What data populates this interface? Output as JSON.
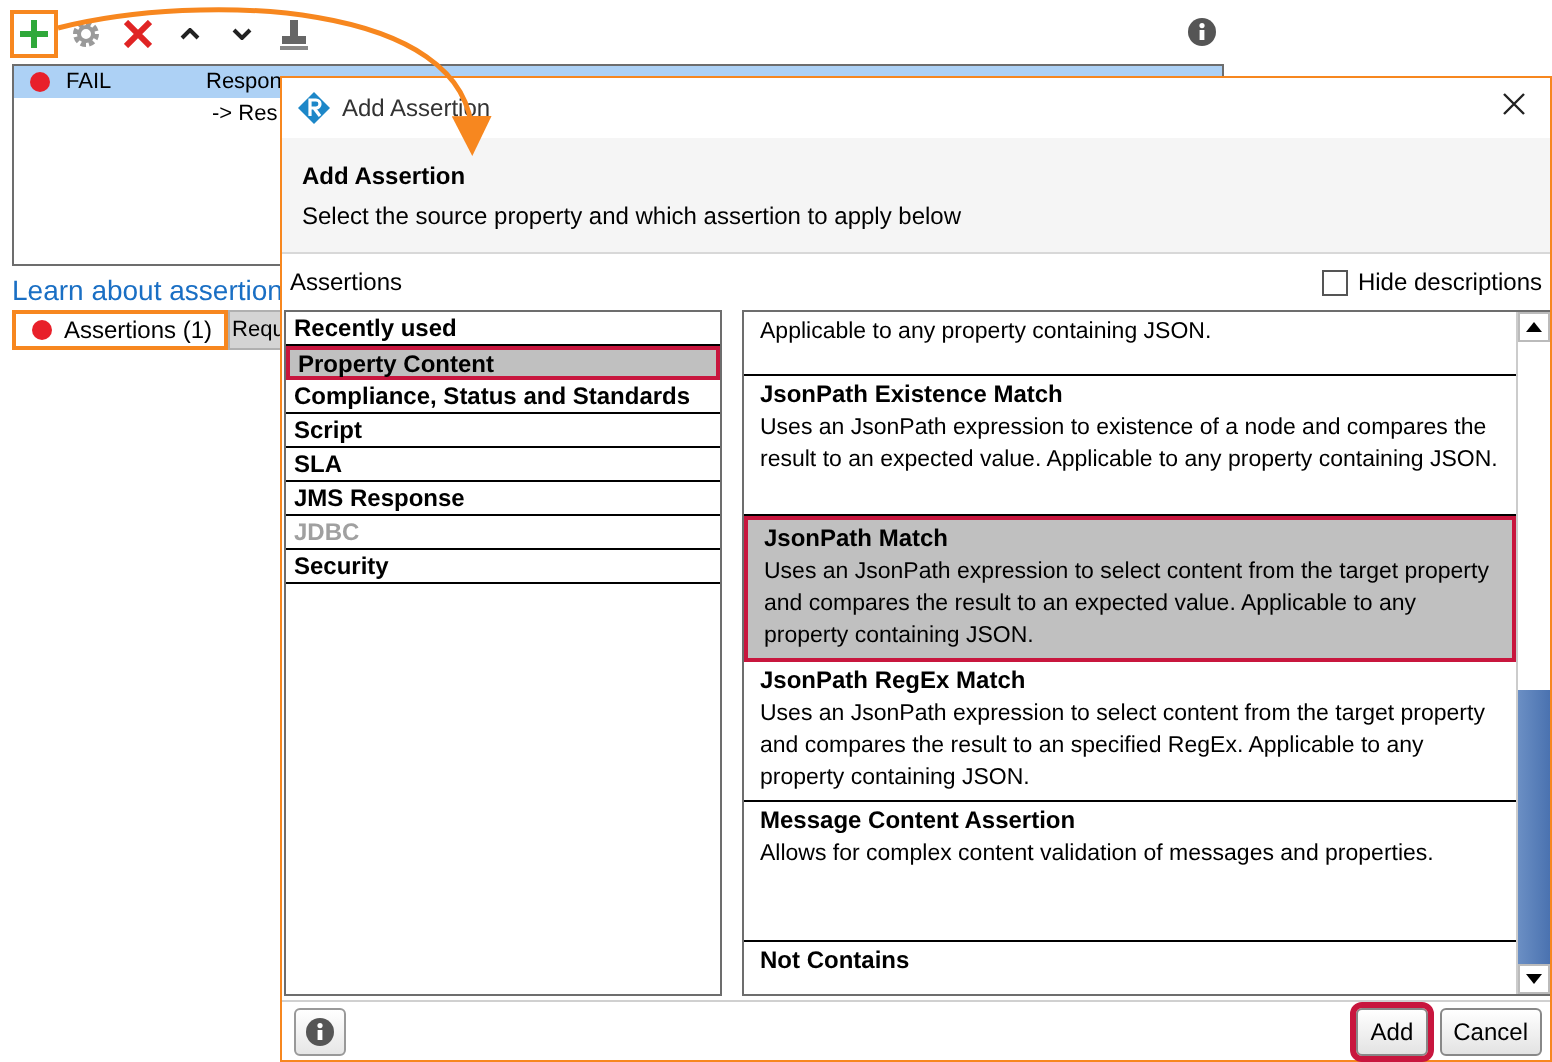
{
  "toolbar": {
    "buttons": [
      {
        "kind": "add",
        "highlighted": true
      },
      {
        "kind": "settings",
        "highlighted": false
      },
      {
        "kind": "delete",
        "highlighted": false
      },
      {
        "kind": "up",
        "highlighted": false
      },
      {
        "kind": "down",
        "highlighted": false
      },
      {
        "kind": "stamp",
        "highlighted": false
      }
    ]
  },
  "assertion_list": {
    "rows": [
      {
        "status": "FAIL",
        "type": "Respon",
        "detail": "-> Res",
        "selected": true,
        "color": "#e8202a"
      }
    ]
  },
  "link": "Learn about assertion",
  "tabs": [
    {
      "label": "Assertions (1)",
      "selected": true,
      "highlighted": true,
      "color": "#e8202a"
    },
    {
      "label": "Requ",
      "selected": false,
      "highlighted": false
    }
  ],
  "dialog": {
    "title": "Add Assertion",
    "heading": "Add Assertion",
    "subtitle": "Select the source property and which assertion to apply below",
    "section_label": "Assertions",
    "hide_descriptions": {
      "label": "Hide descriptions",
      "checked": false
    },
    "categories": [
      {
        "label": "Recently used",
        "selected": false,
        "disabled": false
      },
      {
        "label": "Property Content",
        "selected": true,
        "disabled": false
      },
      {
        "label": "Compliance, Status and Standards",
        "selected": false,
        "disabled": false
      },
      {
        "label": "Script",
        "selected": false,
        "disabled": false
      },
      {
        "label": "SLA",
        "selected": false,
        "disabled": false
      },
      {
        "label": "JMS Response",
        "selected": false,
        "disabled": false
      },
      {
        "label": "JDBC",
        "selected": false,
        "disabled": true
      },
      {
        "label": "Security",
        "selected": false,
        "disabled": false
      }
    ],
    "assertions": [
      {
        "description": "Applicable to any property containing JSON.",
        "selected": false
      },
      {
        "name": "JsonPath Existence Match",
        "description": "Uses an JsonPath expression to existence of a node and compares the result to an expected value. Applicable to any property containing JSON.",
        "selected": false
      },
      {
        "name": "JsonPath Match",
        "description": "Uses an JsonPath expression to select content from the target property and compares the result to an expected value. Applicable to any property containing JSON.",
        "selected": true
      },
      {
        "name": "JsonPath RegEx Match",
        "description": "Uses an JsonPath expression to select content from the target property and compares the result to an specified RegEx. Applicable to any property containing JSON.",
        "selected": false
      },
      {
        "name": "Message Content Assertion",
        "description": "Allows for complex content validation of messages and properties.",
        "selected": false
      },
      {
        "name": "Not Contains",
        "selected": false
      }
    ],
    "buttons": [
      {
        "label": "Add",
        "highlighted": true
      },
      {
        "label": "Cancel",
        "highlighted": false
      }
    ]
  }
}
